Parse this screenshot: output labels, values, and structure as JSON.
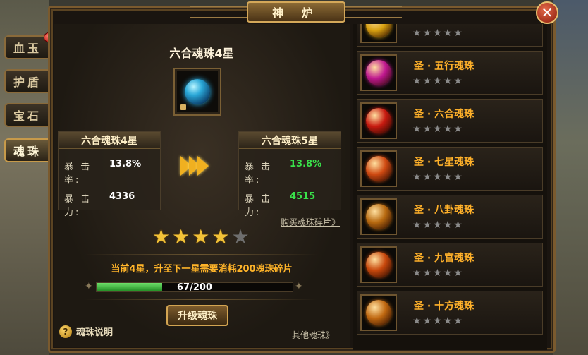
{
  "window": {
    "title": "神 炉",
    "close_symbol": "✕"
  },
  "side_tabs": [
    {
      "label": "血玉",
      "active": false,
      "has_badge": true
    },
    {
      "label": "护盾",
      "active": false,
      "has_badge": false
    },
    {
      "label": "宝石",
      "active": false,
      "has_badge": false
    },
    {
      "label": "魂珠",
      "active": true,
      "has_badge": false
    }
  ],
  "item": {
    "name": "六合魂珠4星",
    "icon": "blue-orb-icon",
    "locked": true
  },
  "current": {
    "title": "六合魂珠4星",
    "crit_rate_label": "暴 击 率:",
    "crit_rate": "13.8%",
    "crit_power_label": "暴 击 力:",
    "crit_power": "4336"
  },
  "next": {
    "title": "六合魂珠5星",
    "crit_rate_label": "暴 击 率:",
    "crit_rate": "13.8%",
    "crit_power_label": "暴 击 力:",
    "crit_power": "4515"
  },
  "buy_link": "购买魂珠碎片》",
  "rating": {
    "filled": 4,
    "total": 5
  },
  "requirement_text": "当前4星，升至下一星需要消耗200魂珠碎片",
  "progress": {
    "current": 67,
    "max": 200,
    "text": "67/200",
    "fraction": 0.335
  },
  "upgrade_button": "升级魂珠",
  "help_label": "魂珠说明",
  "help_symbol": "?",
  "other_link": "其他魂珠》",
  "list": [
    {
      "name": "",
      "orb_color": "#d8a010",
      "stars": 5
    },
    {
      "name": "圣 · 五行魂珠",
      "orb_color": "#c01890",
      "stars": 5
    },
    {
      "name": "圣 · 六合魂珠",
      "orb_color": "#c81a10",
      "stars": 5
    },
    {
      "name": "圣 · 七星魂珠",
      "orb_color": "#d04a12",
      "stars": 5
    },
    {
      "name": "圣 · 八卦魂珠",
      "orb_color": "#b86a10",
      "stars": 5
    },
    {
      "name": "圣 · 九宫魂珠",
      "orb_color": "#c8480c",
      "stars": 5
    },
    {
      "name": "圣 · 十方魂珠",
      "orb_color": "#c06810",
      "stars": 5
    }
  ],
  "colors": {
    "accent_gold": "#ffb12a",
    "increase_green": "#39e14a",
    "frame_border": "#7a5a2e"
  }
}
